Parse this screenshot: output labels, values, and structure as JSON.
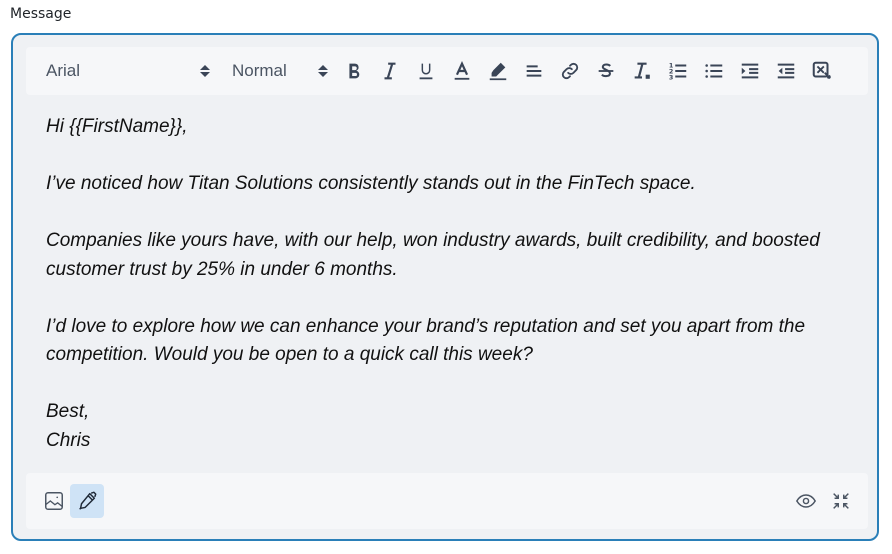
{
  "field": {
    "label": "Message"
  },
  "toolbar": {
    "font_family": "Arial",
    "font_size": "Normal",
    "buttons": [
      {
        "name": "bold",
        "icon": "bold-icon"
      },
      {
        "name": "italic",
        "icon": "italic-icon"
      },
      {
        "name": "underline",
        "icon": "underline-icon"
      },
      {
        "name": "text-color",
        "icon": "text-color-icon"
      },
      {
        "name": "highlight",
        "icon": "highlighter-icon"
      },
      {
        "name": "align",
        "icon": "align-left-icon"
      },
      {
        "name": "link",
        "icon": "link-icon"
      },
      {
        "name": "strikethrough",
        "icon": "strikethrough-icon"
      },
      {
        "name": "clear-formatting",
        "icon": "clear-format-icon"
      },
      {
        "name": "ordered-list",
        "icon": "ordered-list-icon"
      },
      {
        "name": "bullet-list",
        "icon": "bullet-list-icon"
      },
      {
        "name": "indent",
        "icon": "indent-icon"
      },
      {
        "name": "outdent",
        "icon": "outdent-icon"
      },
      {
        "name": "remove-formatting-block",
        "icon": "remove-block-icon"
      }
    ]
  },
  "message": {
    "greeting": "Hi {{FirstName}},",
    "para1": "I’ve noticed how Titan Solutions consistently stands out in the FinTech space.",
    "para2": "Companies like yours have, with our help, won industry awards, built credibility, and boosted customer trust by 25% in under 6 months.",
    "para3": "I’d love to explore how we can enhance your brand’s reputation and set you apart from the competition. Would you be open to a quick call this week?",
    "signoff": "Best,",
    "signature": "Chris"
  },
  "footer": {
    "left": [
      {
        "name": "insert-image",
        "icon": "image-icon",
        "active": false
      },
      {
        "name": "signature",
        "icon": "pen-icon",
        "active": true
      }
    ],
    "right": [
      {
        "name": "preview",
        "icon": "eye-icon"
      },
      {
        "name": "collapse",
        "icon": "minimize-icon"
      }
    ]
  },
  "colors": {
    "accent_border": "#2a7fb8",
    "active_button_bg": "#cfe3f6",
    "icon": "#3a4557"
  }
}
